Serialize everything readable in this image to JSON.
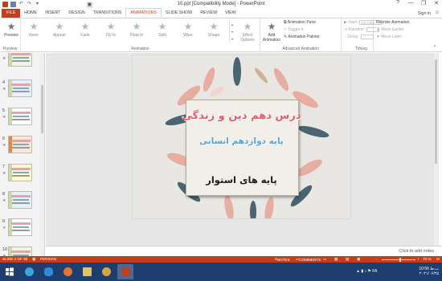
{
  "title_bar": {
    "title": "10.ppt [Compatibility Mode] - PowerPoint",
    "controls": [
      "?",
      "—",
      "❐",
      "✕"
    ]
  },
  "tabs": [
    "FILE",
    "HOME",
    "INSERT",
    "DESIGN",
    "TRANSITIONS",
    "ANIMATIONS",
    "SLIDE SHOW",
    "REVIEW",
    "VIEW"
  ],
  "active_tab": "ANIMATIONS",
  "sign_in": "Sign in",
  "ribbon": {
    "preview": {
      "label": "Preview",
      "group": "Preview"
    },
    "animation_group": "Animation",
    "effects": [
      "None",
      "Appear",
      "Fade",
      "Fly In",
      "Float In",
      "Split",
      "Wipe",
      "Shape"
    ],
    "effect_options": "Effect Options",
    "add_animation": "Add Animation",
    "animation_pane": "Animation Pane",
    "trigger": "Trigger",
    "animation_painter": "Animation Painter",
    "advanced_group": "Advanced Animation",
    "start_label": "Start:",
    "start_value": "On Click",
    "duration_label": "Duration:",
    "delay_label": "Delay:",
    "timing_group": "Timing",
    "reorder_title": "Reorder Animation",
    "move_earlier": "Move Earlier",
    "move_later": "Move Later"
  },
  "thumbnails": [
    {
      "num": "3"
    },
    {
      "num": "4"
    },
    {
      "num": "5"
    },
    {
      "num": "6"
    },
    {
      "num": "7"
    },
    {
      "num": "8"
    },
    {
      "num": "9"
    },
    {
      "num": "10"
    }
  ],
  "slide": {
    "line1": "درس دهم دین و زندگی",
    "line2": "پایه دوازدهم انسانی",
    "line3": "پایه های استوار"
  },
  "notes_placeholder": "Click to add notes",
  "status": {
    "slide_of": "SLIDE 2 OF 38",
    "language": "PERSIAN",
    "notes": "NOTES",
    "comments": "COMMENTS",
    "zoom_minus": "-",
    "zoom_plus": "+",
    "zoom": "70 %",
    "zoom_level_fraction": 0.7
  },
  "taskbar": {
    "time": "10:56 ب.ظ",
    "date": "۲۰۲۱/۰۶/۲۵",
    "lang": "FA"
  },
  "colors": {
    "accent": "#c43e1c",
    "taskbar": "#1f3e70",
    "slide_title": "#e75a6c",
    "slide_subtitle": "#5aa3d6"
  }
}
